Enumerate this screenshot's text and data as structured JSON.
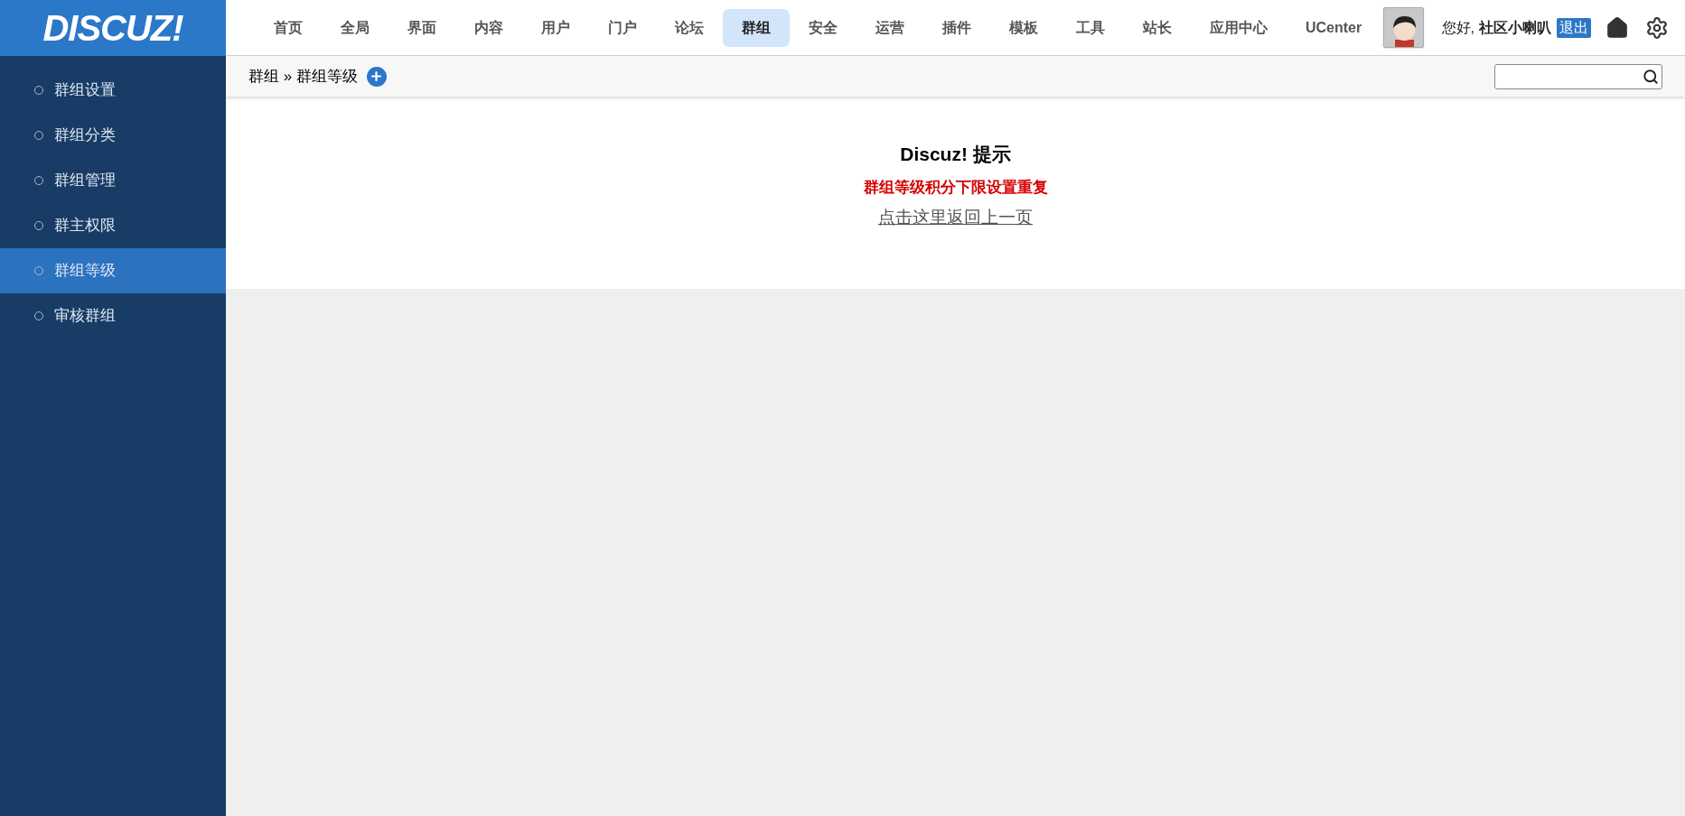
{
  "logo": "DISCUZ!",
  "nav": [
    {
      "label": "首页",
      "selected": false
    },
    {
      "label": "全局",
      "selected": false
    },
    {
      "label": "界面",
      "selected": false
    },
    {
      "label": "内容",
      "selected": false
    },
    {
      "label": "用户",
      "selected": false
    },
    {
      "label": "门户",
      "selected": false
    },
    {
      "label": "论坛",
      "selected": false
    },
    {
      "label": "群组",
      "selected": true
    },
    {
      "label": "安全",
      "selected": false
    },
    {
      "label": "运营",
      "selected": false
    },
    {
      "label": "插件",
      "selected": false
    },
    {
      "label": "模板",
      "selected": false
    },
    {
      "label": "工具",
      "selected": false
    },
    {
      "label": "站长",
      "selected": false
    },
    {
      "label": "应用中心",
      "selected": false
    },
    {
      "label": "UCenter",
      "selected": false
    }
  ],
  "user": {
    "greeting": "您好,",
    "name": "社区小喇叭",
    "logout": "退出"
  },
  "sidebar": {
    "items": [
      {
        "label": "群组设置",
        "selected": false
      },
      {
        "label": "群组分类",
        "selected": false
      },
      {
        "label": "群组管理",
        "selected": false
      },
      {
        "label": "群主权限",
        "selected": false
      },
      {
        "label": "群组等级",
        "selected": true
      },
      {
        "label": "审核群组",
        "selected": false
      }
    ]
  },
  "breadcrumb": {
    "parent": "群组",
    "separator": "»",
    "current": "群组等级"
  },
  "message": {
    "title": "Discuz! 提示",
    "error": "群组等级积分下限设置重复",
    "link": "点击这里返回上一页"
  }
}
